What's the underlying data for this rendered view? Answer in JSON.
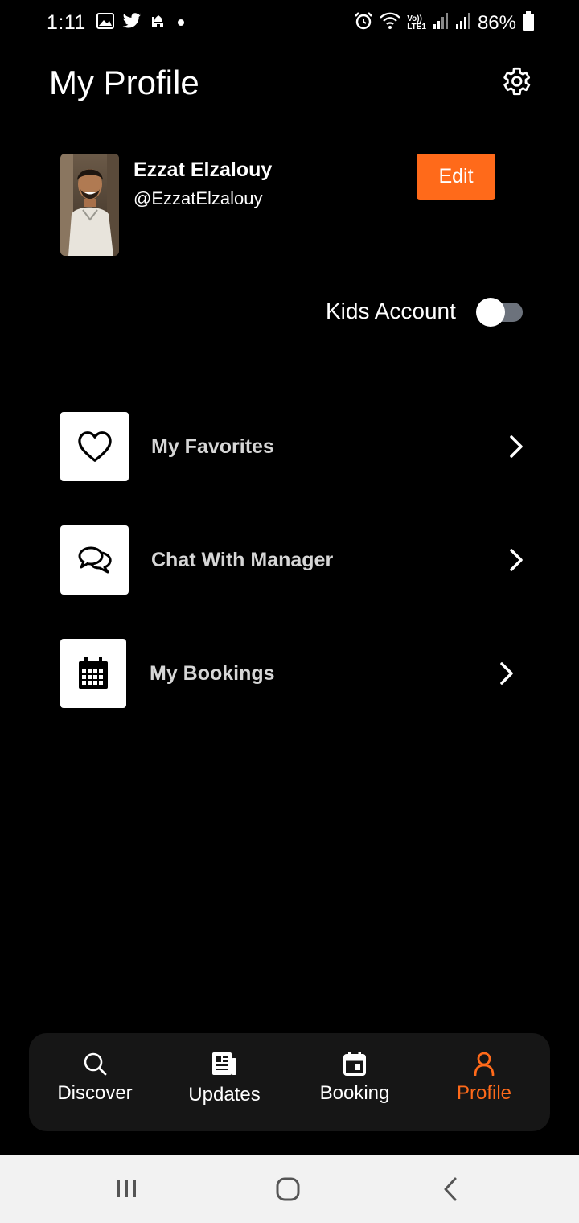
{
  "status_bar": {
    "time": "1:11",
    "battery": "86%",
    "left_icons": [
      "gallery-icon",
      "twitter-icon",
      "mosque-icon",
      "dot-icon"
    ],
    "right_icons": [
      "alarm-icon",
      "wifi-icon",
      "volte-icon",
      "signal-icon",
      "signal-icon",
      "battery-icon"
    ],
    "volte_label_top": "Vo))",
    "volte_label_bottom": "LTE1"
  },
  "header": {
    "title": "My Profile",
    "settings_icon": "gear-icon"
  },
  "profile": {
    "name": "Ezzat Elzalouy",
    "handle": "@EzzatElzalouy",
    "edit_label": "Edit"
  },
  "kids_account": {
    "label": "Kids Account",
    "enabled": false
  },
  "menu": {
    "items": [
      {
        "label": "My Favorites",
        "icon": "heart-icon"
      },
      {
        "label": "Chat With Manager",
        "icon": "chat-bubbles-icon"
      },
      {
        "label": "My Bookings",
        "icon": "calendar-icon"
      }
    ]
  },
  "bottom_nav": {
    "items": [
      {
        "label": "Discover",
        "icon": "search-icon",
        "active": false
      },
      {
        "label": "Updates",
        "icon": "newspaper-icon",
        "active": false
      },
      {
        "label": "Booking",
        "icon": "calendar-icon",
        "active": false
      },
      {
        "label": "Profile",
        "icon": "user-icon",
        "active": true
      }
    ]
  },
  "colors": {
    "accent": "#ff6a1a",
    "background": "#000000",
    "nav_background": "#161616",
    "toggle_track": "#6c727c",
    "menu_label": "#d6d6d6"
  }
}
